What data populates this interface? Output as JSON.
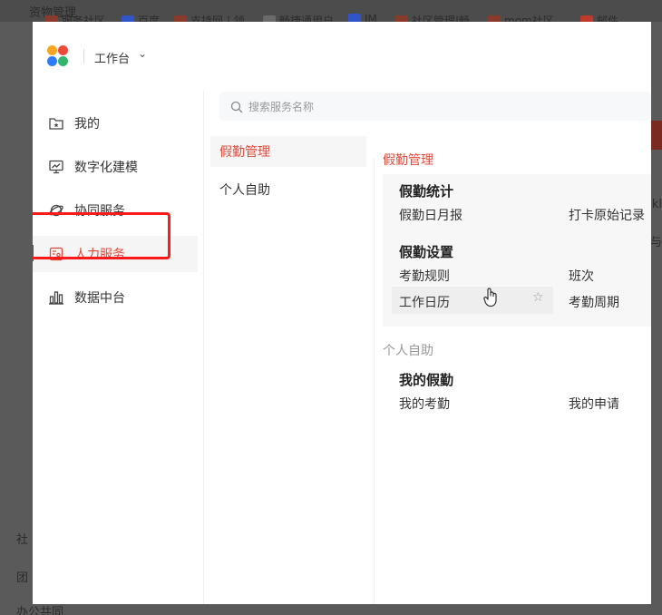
{
  "background": {
    "breadcrumb": "资物管理",
    "tabs": [
      "服务社区",
      "百度",
      "支持网 | 领",
      "畅捷通用户",
      "IM",
      "社区管理|畅",
      "mom社区…",
      "邮件"
    ],
    "side_text": [
      "社",
      "团",
      "办公共同"
    ],
    "right_text": [
      "kl",
      "与"
    ]
  },
  "topbar": {
    "workspace_label": "工作台",
    "chevron": "⌄"
  },
  "nav": {
    "items": [
      {
        "label": "我的",
        "icon": "folder-star-icon"
      },
      {
        "label": "数字化建模",
        "icon": "monitor-chart-icon"
      },
      {
        "label": "协同服务",
        "icon": "orbit-icon"
      },
      {
        "label": "人力服务",
        "icon": "id-card-icon"
      },
      {
        "label": "数据中台",
        "icon": "bar-chart-icon"
      }
    ],
    "active_index": 3
  },
  "search": {
    "placeholder": "搜索服务名称"
  },
  "categories": [
    {
      "label": "假勤管理",
      "active": true
    },
    {
      "label": "个人自助",
      "active": false
    }
  ],
  "content": {
    "group1": {
      "title": "假勤管理",
      "sections": [
        {
          "title": "假勤统计",
          "links": [
            "假勤日月报",
            "打卡原始记录"
          ]
        },
        {
          "title": "假勤设置",
          "links": [
            "考勤规则",
            "班次",
            "工作日历",
            "考勤周期"
          ]
        }
      ]
    },
    "group2": {
      "title": "个人自助",
      "sections": [
        {
          "title": "我的假勤",
          "links": [
            "我的考勤",
            "我的申请"
          ]
        }
      ]
    }
  },
  "colors": {
    "accent": "#e14a3b",
    "highlight_outline": "#ff1a1a"
  }
}
